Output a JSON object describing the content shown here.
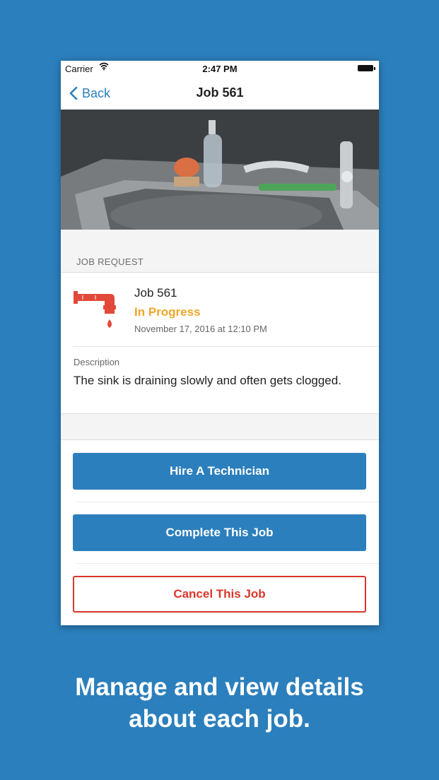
{
  "status_bar": {
    "carrier": "Carrier",
    "time": "2:47 PM"
  },
  "nav": {
    "back_label": "Back",
    "title": "Job 561"
  },
  "hero": {
    "image_icon": "kitchen-sink-photo"
  },
  "section": {
    "header": "JOB REQUEST"
  },
  "job": {
    "icon": "faucet-drip-icon",
    "title": "Job 561",
    "status": "In Progress",
    "date": "November 17, 2016 at 12:10 PM",
    "description_label": "Description",
    "description": "The sink is draining slowly and often gets clogged."
  },
  "actions": {
    "hire_label": "Hire A Technician",
    "complete_label": "Complete This Job",
    "cancel_label": "Cancel This Job"
  },
  "colors": {
    "accent": "#2b7fbc",
    "status": "#f0a62a",
    "danger": "#d9362b"
  },
  "caption": {
    "line1": "Manage and view details",
    "line2": "about each job."
  }
}
